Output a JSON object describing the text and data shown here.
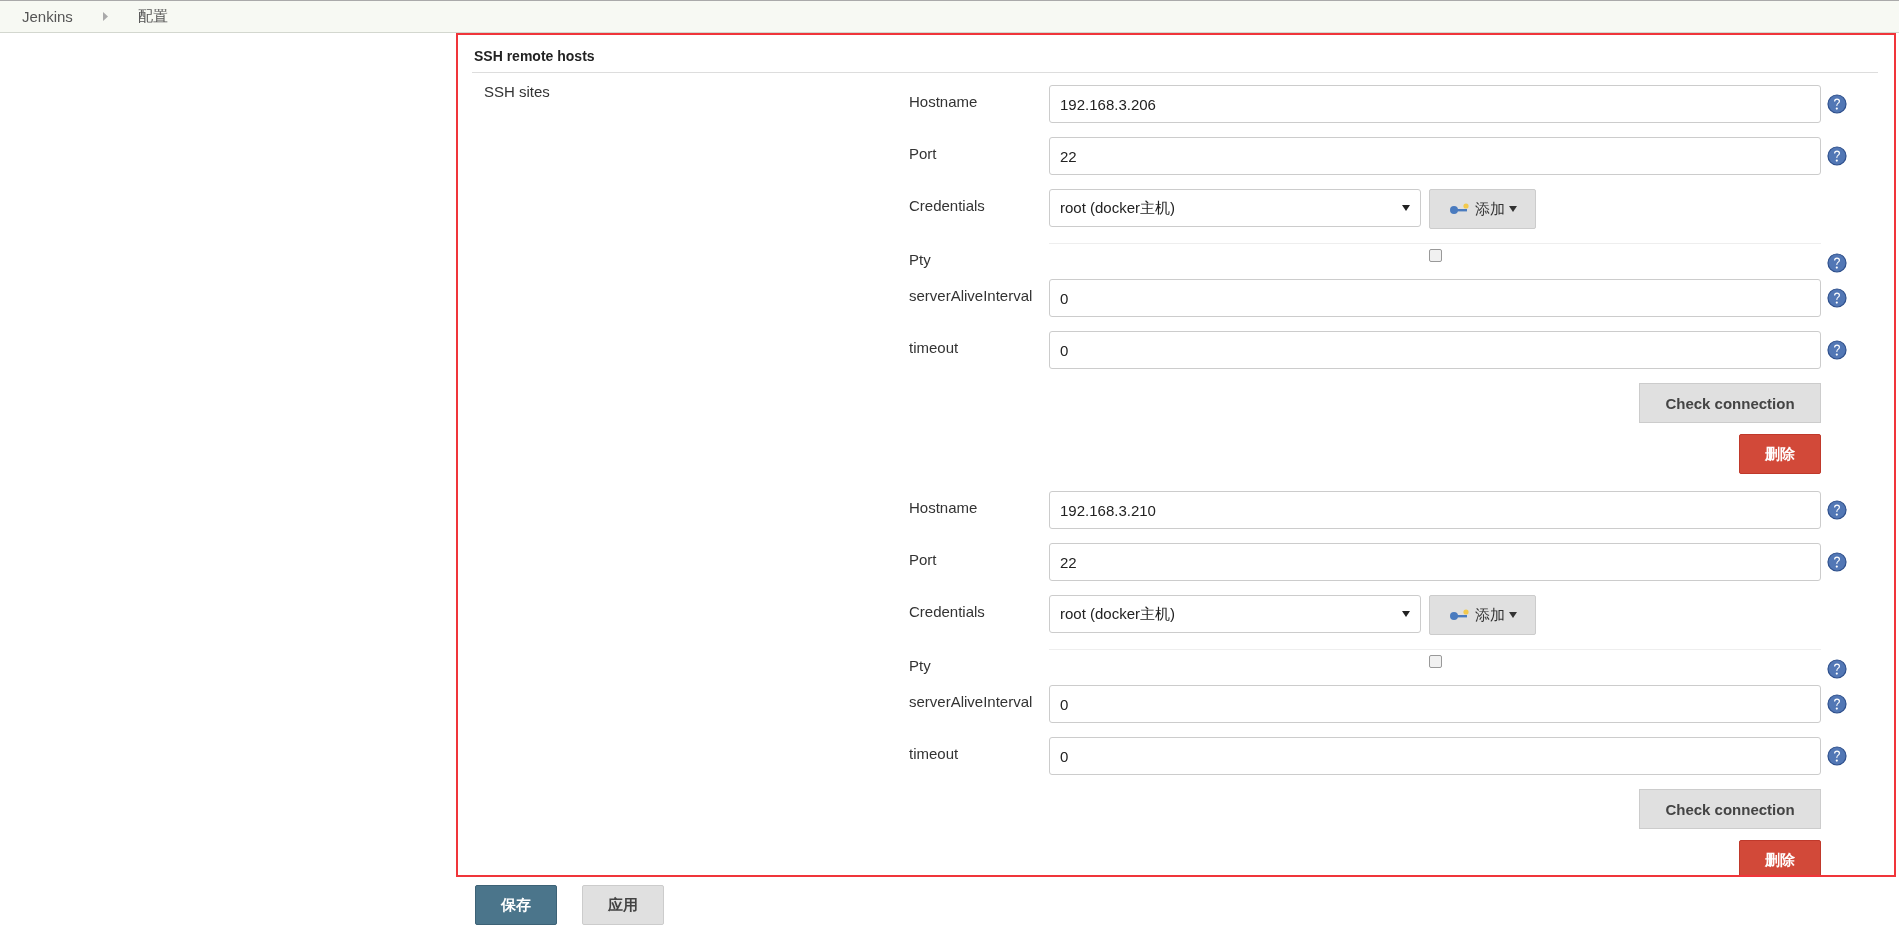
{
  "breadcrumbs": [
    {
      "label": "Jenkins"
    },
    {
      "label": "配置"
    }
  ],
  "section": {
    "title": "SSH remote hosts",
    "label": "SSH sites",
    "sites": [
      {
        "fields": [
          {
            "kind": "text",
            "label": "Hostname",
            "value": "192.168.3.206"
          },
          {
            "kind": "text",
            "label": "Port",
            "value": "22"
          },
          {
            "kind": "select",
            "label": "Credentials",
            "value": "root (docker主机)",
            "add_button": "添加"
          },
          {
            "kind": "checkbox",
            "label": "Pty",
            "checked": false
          },
          {
            "kind": "text",
            "label": "serverAliveInterval",
            "value": "0"
          },
          {
            "kind": "text",
            "label": "timeout",
            "value": "0"
          }
        ],
        "check_button": "Check connection",
        "delete_button": "删除"
      },
      {
        "fields": [
          {
            "kind": "text",
            "label": "Hostname",
            "value": "192.168.3.210"
          },
          {
            "kind": "text",
            "label": "Port",
            "value": "22"
          },
          {
            "kind": "select",
            "label": "Credentials",
            "value": "root (docker主机)",
            "add_button": "添加"
          },
          {
            "kind": "checkbox",
            "label": "Pty",
            "checked": false
          },
          {
            "kind": "text",
            "label": "serverAliveInterval",
            "value": "0"
          },
          {
            "kind": "text",
            "label": "timeout",
            "value": "0"
          }
        ],
        "check_button": "Check connection",
        "delete_button": "删除"
      }
    ]
  },
  "buttons": [
    {
      "kind": "primary",
      "label": "保存"
    },
    {
      "kind": "secondary",
      "label": "应用"
    }
  ]
}
